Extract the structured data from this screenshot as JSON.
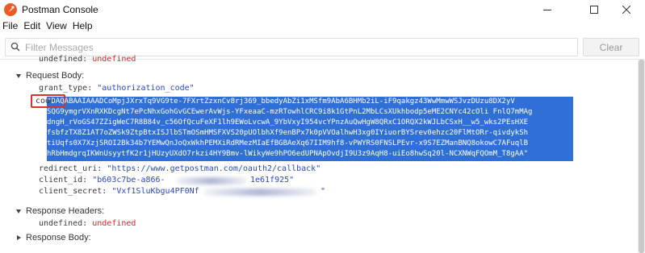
{
  "window": {
    "title": "Postman Console",
    "brand_color": "#ef5b25"
  },
  "menu": [
    "File",
    "Edit",
    "View",
    "Help"
  ],
  "filter": {
    "placeholder": "Filter Messages",
    "value": ""
  },
  "toolbar": {
    "clear_label": "Clear"
  },
  "console": {
    "top_line": {
      "key": "undefined:",
      "value": "undefined"
    },
    "request_body": {
      "label": "Request Body:",
      "grant_type": {
        "key": "grant_type:",
        "value": "\"authorization_code\""
      },
      "code_key": "code:",
      "code_lines": [
        "\"DAQABAAIAAADCoMpjJXrxTq9VG9te-7FXrtZzxnCv8rj369_bbedyAbZi1xMSfm9AbA6BHMb2iL-iF9qakgz43WwMmwWSJvzDUzu8DX2yV",
        "SQG9ymgrVXnRXKDcgNt7ePcNhxGohGvGCEwerAvWjs-YFxeaaC-mzRTowhlCRC9i8k1GtPnL2MbLCsXUkhbodp5eME2CNYc42cOli FnlQ7mMAg",
        "dngH_rVoGS47ZZigWeC7R8B84v_c56OfQcuFeXF1lh9EWoLvcwA_9YbVxyI954vcYPnzAuQwHgW8QRxC1ORQX2kWJLbCSxH__w5_wks2PEsHXE",
        "fsbfzTX8Z1AT7oZWSk9ZtpBtxISJlbSTmOSmHMSFXVS20pUOlbhXf9enBPx7k0pVVOalhwH3xg0IYiuorBYSrev0ehzc20FlMtORr-qivdykSh",
        "tiUqfs0X7XzjSROI2Bk34b7YEMwQnJoQxWkhPEMXiRdRMezMIaEfBGBAeXq67IIM9hf8-vPWYRS0FNSLPEvr-x9S7EZManBNQ8okowC7AFuqlB",
        "hRbHmdgrqIKWnUsyytfK2r1jHUzyUXdO7rkzi4HY9Bmv-lWikyWe9hPO6edUPNApOvdjI9U3z9AqH8-uiEo8hwSq20l-NCXNWqFQOmM_T8gAA\""
      ],
      "redirect_uri": {
        "key": "redirect_uri:",
        "value": "\"https://www.getpostman.com/oauth2/callback\""
      },
      "client_id": {
        "key": "client_id:",
        "value_start": "\"b603c7be-a866-",
        "value_end": "1e61f925\""
      },
      "client_secret": {
        "key": "client_secret:",
        "value_start": "\"Vxf1SluKbgu4PF0Nf",
        "value_end": "\""
      }
    },
    "response_headers": {
      "label": "Response Headers:",
      "line": {
        "key": "undefined:",
        "value": "undefined"
      }
    },
    "response_body": {
      "label": "Response Body:"
    }
  },
  "colors": {
    "selection": "#2f6fd6",
    "annotation": "#e0302a",
    "string": "#2a46c8",
    "undefined": "#d4282b"
  }
}
